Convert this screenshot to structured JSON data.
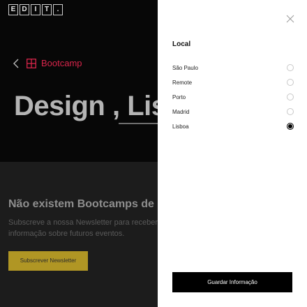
{
  "brand": {
    "logo_letters": [
      "E",
      "D",
      "I",
      "T",
      "."
    ]
  },
  "header": {
    "breadcrumb_label": "Bootcamp",
    "accent_color": "#d9254b"
  },
  "hero": {
    "title": "Design , Lisboa"
  },
  "empty_state": {
    "title": "Não existem Bootcamps de Design",
    "text_line1": "Subscreve a nossa Newsletter para receberes",
    "text_line2": "informação sobre futuros eventos.",
    "subscribe_label": "Subscrever Newsletter",
    "button_color": "#b09624"
  },
  "drawer": {
    "title": "Local",
    "options": [
      {
        "label": "São Paulo",
        "selected": false
      },
      {
        "label": "Remote",
        "selected": false
      },
      {
        "label": "Porto",
        "selected": false
      },
      {
        "label": "Madrid",
        "selected": false
      },
      {
        "label": "Lisboa",
        "selected": true
      }
    ],
    "save_label": "Guardar Informação"
  },
  "icons": {
    "close": "close-icon",
    "back": "chevron-left-icon",
    "bootcamp": "grid-icon"
  }
}
